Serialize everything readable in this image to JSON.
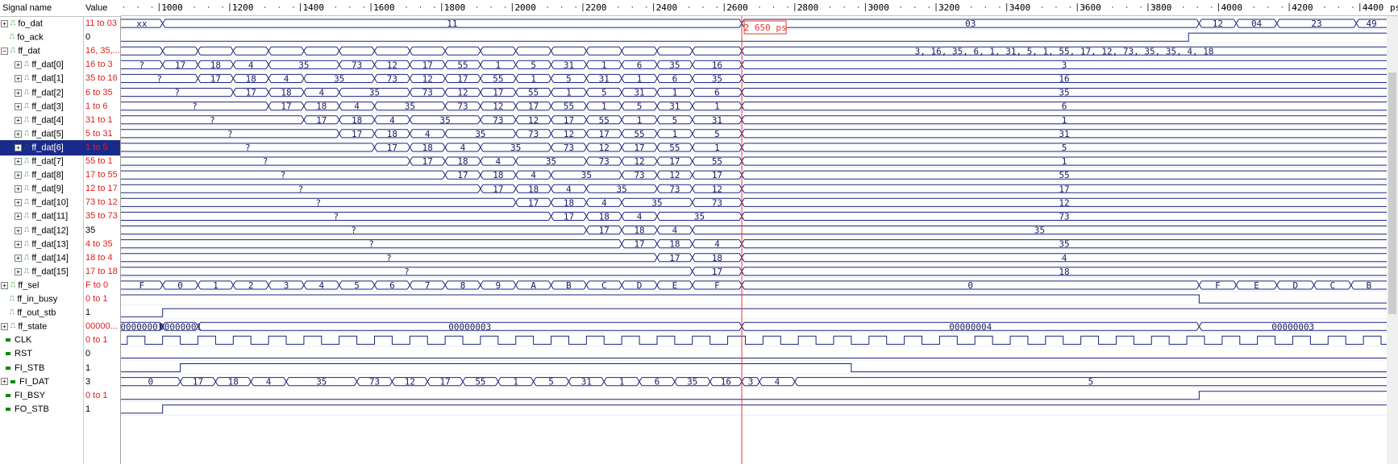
{
  "header": {
    "name_col": "Signal name",
    "value_col": "Value",
    "unit": "ps"
  },
  "ruler": {
    "ticks": [
      1000,
      1200,
      1400,
      1600,
      1800,
      2000,
      2200,
      2400,
      2600,
      2800,
      3000,
      3200,
      3400,
      3600,
      3800,
      4000,
      4200,
      4400
    ]
  },
  "cursor": {
    "label": "2 650 ps",
    "time": 2650
  },
  "timebase": {
    "t0": 892,
    "t1": 4476
  },
  "colors": {
    "wave": "#1a237e",
    "cursor": "#e53935",
    "value_red": "#e0201c",
    "selection": "#1a2a8a"
  },
  "signals": [
    {
      "name": "fo_dat",
      "value": "11 to 03",
      "value_red": true,
      "expander": "plus",
      "level": 0,
      "kind": "bus",
      "segs": [
        [
          892,
          "xx"
        ],
        [
          1010,
          "11"
        ],
        [
          2650,
          "03"
        ],
        [
          3945,
          "12"
        ],
        [
          4050,
          "04"
        ],
        [
          4165,
          "23"
        ],
        [
          4390,
          "49"
        ]
      ]
    },
    {
      "name": "fo_ack",
      "value": "0",
      "value_red": false,
      "expander": "",
      "level": 0,
      "kind": "bit",
      "init": 0,
      "edges": [
        3915
      ]
    },
    {
      "name": "ff_dat",
      "value": "16, 35,...",
      "value_red": true,
      "expander": "minus",
      "level": 0,
      "kind": "bus",
      "segs": [
        [
          892,
          ""
        ],
        [
          1010,
          ""
        ],
        [
          1110,
          ""
        ],
        [
          1210,
          ""
        ],
        [
          1310,
          ""
        ],
        [
          1410,
          ""
        ],
        [
          1510,
          ""
        ],
        [
          1610,
          ""
        ],
        [
          1710,
          ""
        ],
        [
          1810,
          ""
        ],
        [
          1910,
          ""
        ],
        [
          2010,
          ""
        ],
        [
          2110,
          ""
        ],
        [
          2210,
          ""
        ],
        [
          2310,
          ""
        ],
        [
          2410,
          ""
        ],
        [
          2510,
          ""
        ],
        [
          2650,
          "3, 16, 35, 6, 1, 31, 5, 1, 55, 17, 12, 73, 35, 35, 4, 18"
        ]
      ]
    },
    {
      "name": "ff_dat[0]",
      "value": "16 to 3",
      "value_red": true,
      "expander": "plus",
      "level": 1,
      "kind": "bus",
      "segs": [
        [
          892,
          "?"
        ],
        [
          1010,
          "17"
        ],
        [
          1110,
          "18"
        ],
        [
          1210,
          "4"
        ],
        [
          1310,
          "35"
        ],
        [
          1510,
          "73"
        ],
        [
          1610,
          "12"
        ],
        [
          1710,
          "17"
        ],
        [
          1810,
          "55"
        ],
        [
          1910,
          "1"
        ],
        [
          2010,
          "5"
        ],
        [
          2110,
          "31"
        ],
        [
          2210,
          "1"
        ],
        [
          2310,
          "6"
        ],
        [
          2410,
          "35"
        ],
        [
          2510,
          "16"
        ],
        [
          2650,
          "3"
        ]
      ]
    },
    {
      "name": "ff_dat[1]",
      "value": "35 to 16",
      "value_red": true,
      "expander": "plus",
      "level": 1,
      "kind": "bus",
      "segs": [
        [
          892,
          "?"
        ],
        [
          1110,
          "17"
        ],
        [
          1210,
          "18"
        ],
        [
          1310,
          "4"
        ],
        [
          1410,
          "35"
        ],
        [
          1610,
          "73"
        ],
        [
          1710,
          "12"
        ],
        [
          1810,
          "17"
        ],
        [
          1910,
          "55"
        ],
        [
          2010,
          "1"
        ],
        [
          2110,
          "5"
        ],
        [
          2210,
          "31"
        ],
        [
          2310,
          "1"
        ],
        [
          2410,
          "6"
        ],
        [
          2510,
          "35"
        ],
        [
          2650,
          "16"
        ]
      ]
    },
    {
      "name": "ff_dat[2]",
      "value": "6 to 35",
      "value_red": true,
      "expander": "plus",
      "level": 1,
      "kind": "bus",
      "segs": [
        [
          892,
          "?"
        ],
        [
          1210,
          "17"
        ],
        [
          1310,
          "18"
        ],
        [
          1410,
          "4"
        ],
        [
          1510,
          "35"
        ],
        [
          1710,
          "73"
        ],
        [
          1810,
          "12"
        ],
        [
          1910,
          "17"
        ],
        [
          2010,
          "55"
        ],
        [
          2110,
          "1"
        ],
        [
          2210,
          "5"
        ],
        [
          2310,
          "31"
        ],
        [
          2410,
          "1"
        ],
        [
          2510,
          "6"
        ],
        [
          2650,
          "35"
        ]
      ]
    },
    {
      "name": "ff_dat[3]",
      "value": "1 to 6",
      "value_red": true,
      "expander": "plus",
      "level": 1,
      "kind": "bus",
      "segs": [
        [
          892,
          "?"
        ],
        [
          1310,
          "17"
        ],
        [
          1410,
          "18"
        ],
        [
          1510,
          "4"
        ],
        [
          1610,
          "35"
        ],
        [
          1810,
          "73"
        ],
        [
          1910,
          "12"
        ],
        [
          2010,
          "17"
        ],
        [
          2110,
          "55"
        ],
        [
          2210,
          "1"
        ],
        [
          2310,
          "5"
        ],
        [
          2410,
          "31"
        ],
        [
          2510,
          "1"
        ],
        [
          2650,
          "6"
        ]
      ]
    },
    {
      "name": "ff_dat[4]",
      "value": "31 to 1",
      "value_red": true,
      "expander": "plus",
      "level": 1,
      "kind": "bus",
      "segs": [
        [
          892,
          "?"
        ],
        [
          1410,
          "17"
        ],
        [
          1510,
          "18"
        ],
        [
          1610,
          "4"
        ],
        [
          1710,
          "35"
        ],
        [
          1910,
          "73"
        ],
        [
          2010,
          "12"
        ],
        [
          2110,
          "17"
        ],
        [
          2210,
          "55"
        ],
        [
          2310,
          "1"
        ],
        [
          2410,
          "5"
        ],
        [
          2510,
          "31"
        ],
        [
          2650,
          "1"
        ]
      ]
    },
    {
      "name": "ff_dat[5]",
      "value": "5 to 31",
      "value_red": true,
      "expander": "plus",
      "level": 1,
      "kind": "bus",
      "segs": [
        [
          892,
          "?"
        ],
        [
          1510,
          "17"
        ],
        [
          1610,
          "18"
        ],
        [
          1710,
          "4"
        ],
        [
          1810,
          "35"
        ],
        [
          2010,
          "73"
        ],
        [
          2110,
          "12"
        ],
        [
          2210,
          "17"
        ],
        [
          2310,
          "55"
        ],
        [
          2410,
          "1"
        ],
        [
          2510,
          "5"
        ],
        [
          2650,
          "31"
        ]
      ]
    },
    {
      "name": "ff_dat[6]",
      "value": "1 to 5",
      "value_red": true,
      "selected": true,
      "expander": "plus",
      "level": 1,
      "kind": "bus",
      "segs": [
        [
          892,
          "?"
        ],
        [
          1610,
          "17"
        ],
        [
          1710,
          "18"
        ],
        [
          1810,
          "4"
        ],
        [
          1910,
          "35"
        ],
        [
          2110,
          "73"
        ],
        [
          2210,
          "12"
        ],
        [
          2310,
          "17"
        ],
        [
          2410,
          "55"
        ],
        [
          2510,
          "1"
        ],
        [
          2650,
          "5"
        ]
      ]
    },
    {
      "name": "ff_dat[7]",
      "value": "55 to 1",
      "value_red": true,
      "expander": "plus",
      "level": 1,
      "kind": "bus",
      "segs": [
        [
          892,
          "?"
        ],
        [
          1710,
          "17"
        ],
        [
          1810,
          "18"
        ],
        [
          1910,
          "4"
        ],
        [
          2010,
          "35"
        ],
        [
          2210,
          "73"
        ],
        [
          2310,
          "12"
        ],
        [
          2410,
          "17"
        ],
        [
          2510,
          "55"
        ],
        [
          2650,
          "1"
        ]
      ]
    },
    {
      "name": "ff_dat[8]",
      "value": "17 to 55",
      "value_red": true,
      "expander": "plus",
      "level": 1,
      "kind": "bus",
      "segs": [
        [
          892,
          "?"
        ],
        [
          1810,
          "17"
        ],
        [
          1910,
          "18"
        ],
        [
          2010,
          "4"
        ],
        [
          2110,
          "35"
        ],
        [
          2310,
          "73"
        ],
        [
          2410,
          "12"
        ],
        [
          2510,
          "17"
        ],
        [
          2650,
          "55"
        ]
      ]
    },
    {
      "name": "ff_dat[9]",
      "value": "12 to 17",
      "value_red": true,
      "expander": "plus",
      "level": 1,
      "kind": "bus",
      "segs": [
        [
          892,
          "?"
        ],
        [
          1910,
          "17"
        ],
        [
          2010,
          "18"
        ],
        [
          2110,
          "4"
        ],
        [
          2210,
          "35"
        ],
        [
          2410,
          "73"
        ],
        [
          2510,
          "12"
        ],
        [
          2650,
          "17"
        ]
      ]
    },
    {
      "name": "ff_dat[10]",
      "value": "73 to 12",
      "value_red": true,
      "expander": "plus",
      "level": 1,
      "kind": "bus",
      "segs": [
        [
          892,
          "?"
        ],
        [
          2010,
          "17"
        ],
        [
          2110,
          "18"
        ],
        [
          2210,
          "4"
        ],
        [
          2310,
          "35"
        ],
        [
          2510,
          "73"
        ],
        [
          2650,
          "12"
        ]
      ]
    },
    {
      "name": "ff_dat[11]",
      "value": "35 to 73",
      "value_red": true,
      "expander": "plus",
      "level": 1,
      "kind": "bus",
      "segs": [
        [
          892,
          "?"
        ],
        [
          2110,
          "17"
        ],
        [
          2210,
          "18"
        ],
        [
          2310,
          "4"
        ],
        [
          2410,
          "35"
        ],
        [
          2650,
          "73"
        ]
      ]
    },
    {
      "name": "ff_dat[12]",
      "value": "35",
      "value_red": false,
      "expander": "plus",
      "level": 1,
      "kind": "bus",
      "segs": [
        [
          892,
          "?"
        ],
        [
          2210,
          "17"
        ],
        [
          2310,
          "18"
        ],
        [
          2410,
          "4"
        ],
        [
          2510,
          "35"
        ]
      ]
    },
    {
      "name": "ff_dat[13]",
      "value": "4 to 35",
      "value_red": true,
      "expander": "plus",
      "level": 1,
      "kind": "bus",
      "segs": [
        [
          892,
          "?"
        ],
        [
          2310,
          "17"
        ],
        [
          2410,
          "18"
        ],
        [
          2510,
          "4"
        ],
        [
          2650,
          "35"
        ]
      ]
    },
    {
      "name": "ff_dat[14]",
      "value": "18 to 4",
      "value_red": true,
      "expander": "plus",
      "level": 1,
      "kind": "bus",
      "segs": [
        [
          892,
          "?"
        ],
        [
          2410,
          "17"
        ],
        [
          2510,
          "18"
        ],
        [
          2650,
          "4"
        ]
      ]
    },
    {
      "name": "ff_dat[15]",
      "value": "17 to 18",
      "value_red": true,
      "expander": "plus",
      "level": 1,
      "kind": "bus",
      "segs": [
        [
          892,
          "?"
        ],
        [
          2510,
          "17"
        ],
        [
          2650,
          "18"
        ]
      ]
    },
    {
      "name": "ff_sel",
      "value": "F to 0",
      "value_red": true,
      "expander": "plus",
      "level": 0,
      "kind": "bus",
      "segs": [
        [
          892,
          "F"
        ],
        [
          1010,
          "0"
        ],
        [
          1110,
          "1"
        ],
        [
          1210,
          "2"
        ],
        [
          1310,
          "3"
        ],
        [
          1410,
          "4"
        ],
        [
          1510,
          "5"
        ],
        [
          1610,
          "6"
        ],
        [
          1710,
          "7"
        ],
        [
          1810,
          "8"
        ],
        [
          1910,
          "9"
        ],
        [
          2010,
          "A"
        ],
        [
          2110,
          "B"
        ],
        [
          2210,
          "C"
        ],
        [
          2310,
          "D"
        ],
        [
          2410,
          "E"
        ],
        [
          2510,
          "F"
        ],
        [
          2650,
          "0"
        ],
        [
          3945,
          "F"
        ],
        [
          4050,
          "E"
        ],
        [
          4165,
          "D"
        ],
        [
          4270,
          "C"
        ],
        [
          4375,
          "B"
        ]
      ]
    },
    {
      "name": "ff_in_busy",
      "value": "0 to 1",
      "value_red": true,
      "expander": "",
      "level": 0,
      "kind": "bit",
      "init": 1,
      "edges": [
        3945
      ]
    },
    {
      "name": "ff_out_stb",
      "value": "1",
      "value_red": false,
      "expander": "",
      "level": 0,
      "kind": "bit",
      "init": 0,
      "edges": [
        1010
      ]
    },
    {
      "name": "ff_state",
      "value": "00000...",
      "value_red": true,
      "expander": "plus",
      "level": 0,
      "kind": "bus",
      "segs": [
        [
          892,
          "00000001"
        ],
        [
          1010,
          "00000001"
        ],
        [
          1110,
          "00000003"
        ],
        [
          2650,
          "00000004"
        ],
        [
          3945,
          "00000003"
        ]
      ]
    },
    {
      "name": "CLK",
      "value": "0 to 1",
      "value_red": true,
      "expander": "",
      "level": 0,
      "kind": "clk",
      "pin": true,
      "period": 100,
      "first": 910
    },
    {
      "name": "RST",
      "value": "0",
      "value_red": false,
      "expander": "",
      "level": 0,
      "kind": "bit",
      "pin": true,
      "init": 0,
      "edges": []
    },
    {
      "name": "FI_STB",
      "value": "1",
      "value_red": false,
      "expander": "",
      "level": 0,
      "kind": "bit",
      "pin": true,
      "init": 0,
      "edges": [
        1060,
        2960
      ]
    },
    {
      "name": "FI_DAT",
      "value": "3",
      "value_red": false,
      "expander": "plus",
      "level": 0,
      "kind": "bus",
      "pin": true,
      "segs": [
        [
          892,
          "0"
        ],
        [
          1060,
          "17"
        ],
        [
          1160,
          "18"
        ],
        [
          1260,
          "4"
        ],
        [
          1360,
          "35"
        ],
        [
          1560,
          "73"
        ],
        [
          1660,
          "12"
        ],
        [
          1760,
          "17"
        ],
        [
          1860,
          "55"
        ],
        [
          1960,
          "1"
        ],
        [
          2060,
          "5"
        ],
        [
          2160,
          "31"
        ],
        [
          2260,
          "1"
        ],
        [
          2360,
          "6"
        ],
        [
          2460,
          "35"
        ],
        [
          2560,
          "16"
        ],
        [
          2650,
          "3"
        ],
        [
          2700,
          "4"
        ],
        [
          2800,
          "5"
        ]
      ]
    },
    {
      "name": "FI_BSY",
      "value": "0 to 1",
      "value_red": true,
      "expander": "",
      "level": 0,
      "kind": "bit",
      "pin": true,
      "init": 0,
      "edges": [
        3945
      ]
    },
    {
      "name": "FO_STB",
      "value": "1",
      "value_red": false,
      "expander": "",
      "level": 0,
      "kind": "bit",
      "pin": true,
      "init": 0,
      "edges": [
        1010
      ]
    }
  ]
}
